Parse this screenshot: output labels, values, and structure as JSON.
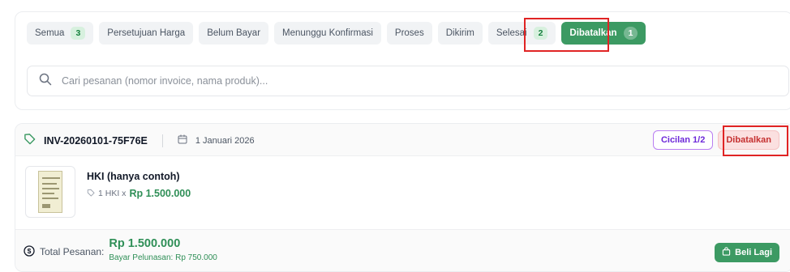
{
  "tabs": [
    {
      "label": "Semua",
      "count": "3"
    },
    {
      "label": "Persetujuan Harga"
    },
    {
      "label": "Belum Bayar"
    },
    {
      "label": "Menunggu Konfirmasi"
    },
    {
      "label": "Proses"
    },
    {
      "label": "Dikirim"
    },
    {
      "label": "Selesai",
      "count": "2"
    },
    {
      "label": "Dibatalkan",
      "count": "1"
    }
  ],
  "search": {
    "placeholder": "Cari pesanan (nomor invoice, nama produk)...",
    "icon": "search-icon"
  },
  "order": {
    "invoice": "INV-20260101-75F76E",
    "date": "1 Januari 2026",
    "badges": {
      "installment": "Cicilan 1/2",
      "status": "Dibatalkan"
    },
    "product": {
      "name": "HKI (hanya contoh)",
      "qty": "1 HKI x",
      "price": "Rp 1.500.000"
    },
    "total_label": "Total Pesanan:",
    "total": "Rp 1.500.000",
    "settlement": "Bayar Pelunasan: Rp 750.000",
    "buy_again": "Beli Lagi"
  },
  "colors": {
    "accent": "#3c9a63",
    "highlight": "#e02424",
    "cancelled": "#c53030",
    "installment": "#b97ef2"
  }
}
